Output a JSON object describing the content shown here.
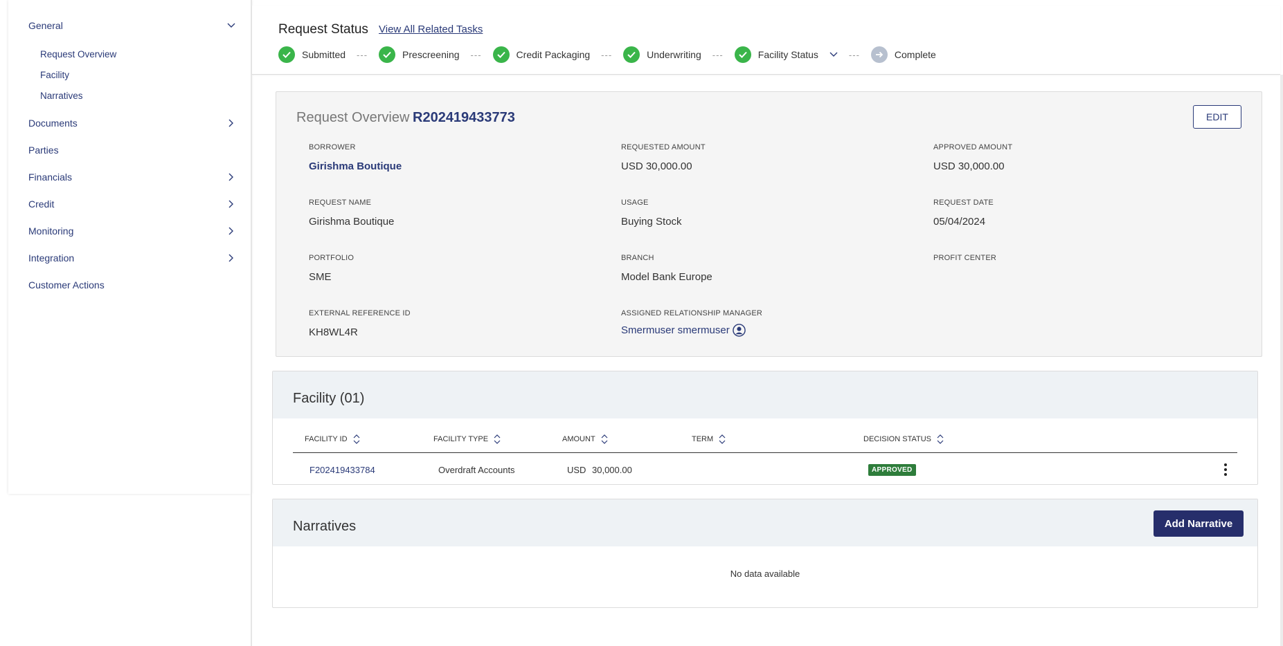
{
  "sidebar": {
    "general": {
      "label": "General",
      "icon": "chevron-down-icon"
    },
    "general_items": [
      "Request Overview",
      "Facility",
      "Narratives"
    ],
    "sections": [
      {
        "label": "Documents",
        "has_children": true
      },
      {
        "label": "Parties",
        "has_children": false
      },
      {
        "label": "Financials",
        "has_children": true
      },
      {
        "label": "Credit",
        "has_children": true
      },
      {
        "label": "Monitoring",
        "has_children": true
      },
      {
        "label": "Integration",
        "has_children": true
      },
      {
        "label": "Customer Actions",
        "has_children": false
      }
    ]
  },
  "header": {
    "title": "Request Status",
    "related_link": "View All Related Tasks",
    "steps": [
      {
        "label": "Submitted",
        "status": "done"
      },
      {
        "label": "Prescreening",
        "status": "done"
      },
      {
        "label": "Credit Packaging",
        "status": "done"
      },
      {
        "label": "Underwriting",
        "status": "done"
      },
      {
        "label": "Facility Status",
        "status": "done",
        "dropdown": true
      },
      {
        "label": "Complete",
        "status": "pending"
      }
    ],
    "step_separator": "---"
  },
  "overview": {
    "title": "Request Overview",
    "request_id": "R202419433773",
    "edit_label": "EDIT",
    "fields": {
      "borrower": {
        "label": "BORROWER",
        "value": "Girishma Boutique"
      },
      "requested_amount": {
        "label": "REQUESTED AMOUNT",
        "value": "USD 30,000.00"
      },
      "approved_amount": {
        "label": "APPROVED AMOUNT",
        "value": "USD 30,000.00"
      },
      "request_name": {
        "label": "REQUEST NAME",
        "value": "Girishma Boutique"
      },
      "usage": {
        "label": "USAGE",
        "value": "Buying Stock"
      },
      "request_date": {
        "label": "REQUEST DATE",
        "value": "05/04/2024"
      },
      "portfolio": {
        "label": "PORTFOLIO",
        "value": "SME"
      },
      "branch": {
        "label": "BRANCH",
        "value": "Model Bank Europe"
      },
      "profit_center": {
        "label": "PROFIT CENTER",
        "value": ""
      },
      "external_ref": {
        "label": "EXTERNAL REFERENCE ID",
        "value": "KH8WL4R"
      },
      "relationship_manager": {
        "label": "ASSIGNED RELATIONSHIP MANAGER",
        "value": "Smermuser smermuser"
      }
    }
  },
  "facility": {
    "title": "Facility (01)",
    "columns": [
      "FACILITY ID",
      "FACILITY TYPE",
      "AMOUNT",
      "TERM",
      "DECISION STATUS"
    ],
    "rows": [
      {
        "facility_id": "F202419433784",
        "facility_type": "Overdraft Accounts",
        "currency": "USD",
        "amount": "30,000.00",
        "term": "",
        "status": "APPROVED"
      }
    ]
  },
  "narratives": {
    "title": "Narratives",
    "add_label": "Add Narrative",
    "empty_text": "No data available"
  },
  "colors": {
    "accent": "#2a3a78",
    "success": "#3ab54a",
    "approved_badge": "#2e7d3b",
    "pending_step": "#b7c0cf"
  }
}
